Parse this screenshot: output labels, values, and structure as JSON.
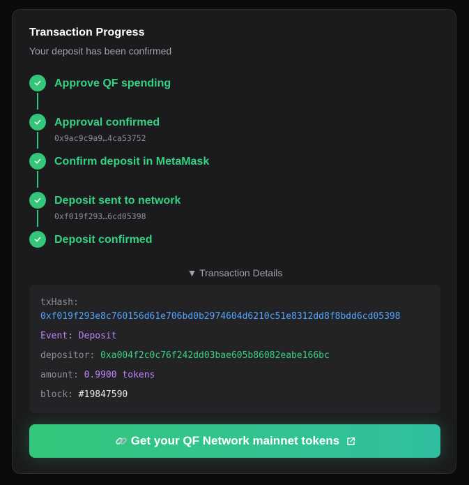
{
  "panel": {
    "title": "Transaction Progress",
    "subtitle": "Your deposit has been confirmed"
  },
  "steps": [
    {
      "label": "Approve QF spending",
      "hash": ""
    },
    {
      "label": "Approval confirmed",
      "hash": "0x9ac9c9a9…4ca53752"
    },
    {
      "label": "Confirm deposit in MetaMask",
      "hash": ""
    },
    {
      "label": "Deposit sent to network",
      "hash": "0xf019f293…6cd05398"
    },
    {
      "label": "Deposit confirmed",
      "hash": ""
    }
  ],
  "details": {
    "toggle_label": "▼ Transaction Details",
    "tx_hash_label": "txHash:",
    "tx_hash_value": "0xf019f293e8c760156d61e706bd0b2974604d6210c51e8312dd8f8bdd6cd05398",
    "event_label": "Event:",
    "event_value": "Deposit",
    "depositor_label": "depositor:",
    "depositor_value": "0xa004f2c0c76f242dd03bae605b86082eabe166bc",
    "amount_label": "amount:",
    "amount_value": "0.9900 tokens",
    "block_label": "block:",
    "block_value": "#19847590"
  },
  "cta": {
    "label": "Get your QF Network mainnet tokens",
    "icon": "link-icon",
    "trailing_icon": "external-link-icon"
  },
  "colors": {
    "success": "#34c77b",
    "link": "#4fa3ff",
    "event": "#c084fc",
    "background": "#1b1b1d"
  }
}
